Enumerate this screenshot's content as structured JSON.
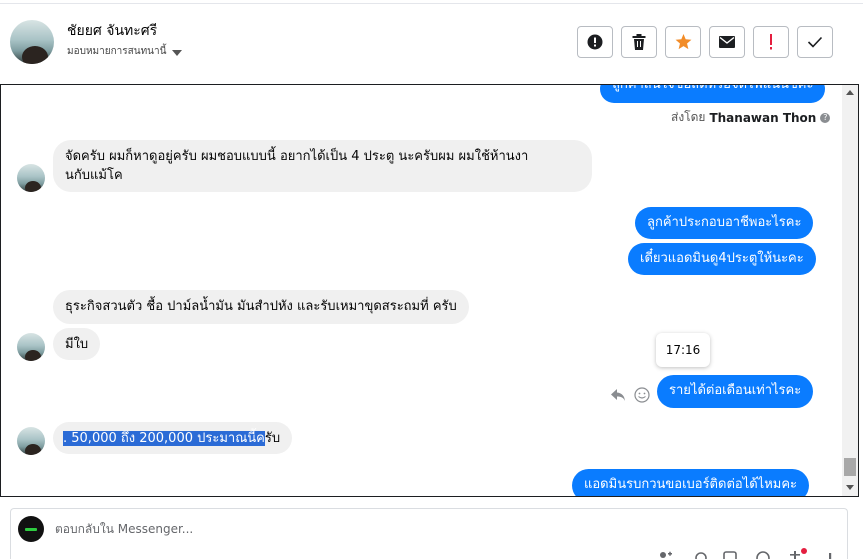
{
  "header": {
    "customer_name": "ชัยยศ จันทะศรี",
    "assign_label": "มอบหมายการสนทนานี้",
    "actions": [
      {
        "icon": "alert-circle-icon",
        "name": "spam-button"
      },
      {
        "icon": "trash-icon",
        "name": "delete-button"
      },
      {
        "icon": "star-icon",
        "name": "star-button",
        "color": "#f28c28"
      },
      {
        "icon": "envelope-icon",
        "name": "mark-unread-button"
      },
      {
        "icon": "exclamation-icon",
        "name": "follow-up-button",
        "color": "#e41e3f"
      },
      {
        "icon": "check-icon",
        "name": "mark-done-button"
      }
    ]
  },
  "chat": {
    "sent_by_prefix": "ส่งโดย",
    "sent_by_name": "Thanawan Thon",
    "messages": [
      {
        "side": "out",
        "text": "ลูกค้าสนใจซื้อสดหรือจัดไฟแนนซ์คะ"
      },
      {
        "side": "in",
        "text": "จัดครับ ผมก็หาดูอยู่ครับ ผมชอบแบบนี้ อยากได้เป็น 4 ประตู นะครับผม ผมใช้ห้านงา",
        "text2": "นกับแม้โค"
      },
      {
        "side": "out",
        "text": "ลูกค้าประกอบอาชีพอะไรคะ"
      },
      {
        "side": "out",
        "text": "เดี๋ยวแอดมินดู4ประตูให้นะคะ"
      },
      {
        "side": "in",
        "text": "ธุระกิจสวนตัว ชื้อ ปาม์ลน้ำมัน มันสำปหัง และรับเหมาขุดสระถมที่ ครับ"
      },
      {
        "side": "in",
        "text": "มีใบ"
      },
      {
        "side": "out",
        "text": "รายได้ต่อเดือนเท่าไรคะ"
      },
      {
        "side": "in",
        "text_highlight": ". 50,000 ถึง 200,000 ประมาณนี้ค",
        "text_rest": "รับ"
      },
      {
        "side": "out",
        "text": "แอดมินรบกวนขอเบอร์ติดต่อได้ไหมคะ"
      }
    ],
    "tooltip_time": "17:16",
    "accent_color": "#0a7cff"
  },
  "composer": {
    "placeholder": "ตอบกลับใน Messenger..."
  }
}
